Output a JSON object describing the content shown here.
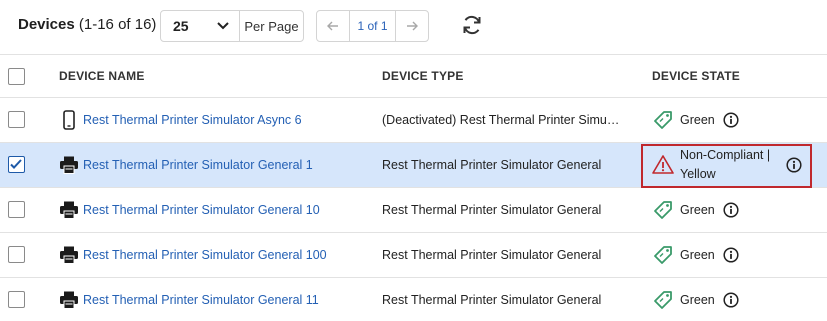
{
  "toolbar": {
    "title_bold": "Devices",
    "title_count": " (1-16 of 16)",
    "per_page_value": "25",
    "per_page_label": "Per Page",
    "prev_icon": "arrow-left-icon",
    "next_icon": "arrow-right-icon",
    "page_indicator": "1 of 1",
    "refresh_icon": "refresh-icon"
  },
  "table": {
    "columns": [
      "DEVICE NAME",
      "DEVICE TYPE",
      "DEVICE STATE"
    ],
    "rows": [
      {
        "name": "Rest Thermal Printer Simulator Async 6",
        "type": "(Deactivated) Rest Thermal Printer Simulator Async",
        "state": "Green",
        "icon": "mobile-device-icon",
        "state_icon": "tag-icon",
        "checked": false
      },
      {
        "name": "Rest Thermal Printer Simulator General 1",
        "type": "Rest Thermal Printer Simulator General",
        "state": "Non-Compliant | Yellow",
        "state_line1": "Non-Compliant |",
        "state_line2": "Yellow",
        "icon": "printer-icon",
        "state_icon": "warning-icon",
        "checked": true
      },
      {
        "name": "Rest Thermal Printer Simulator General 10",
        "type": "Rest Thermal Printer Simulator General",
        "state": "Green",
        "icon": "printer-icon",
        "state_icon": "tag-icon",
        "checked": false
      },
      {
        "name": "Rest Thermal Printer Simulator General 100",
        "type": "Rest Thermal Printer Simulator General",
        "state": "Green",
        "icon": "printer-icon",
        "state_icon": "tag-icon",
        "checked": false
      },
      {
        "name": "Rest Thermal Printer Simulator General 11",
        "type": "Rest Thermal Printer Simulator General",
        "state": "Green",
        "icon": "printer-icon",
        "state_icon": "tag-icon",
        "checked": false
      }
    ]
  },
  "colors": {
    "link": "#2460b4",
    "selected_row": "#d6e6fb",
    "green_state": "#3a9a6a",
    "warning": "#c0282d"
  }
}
